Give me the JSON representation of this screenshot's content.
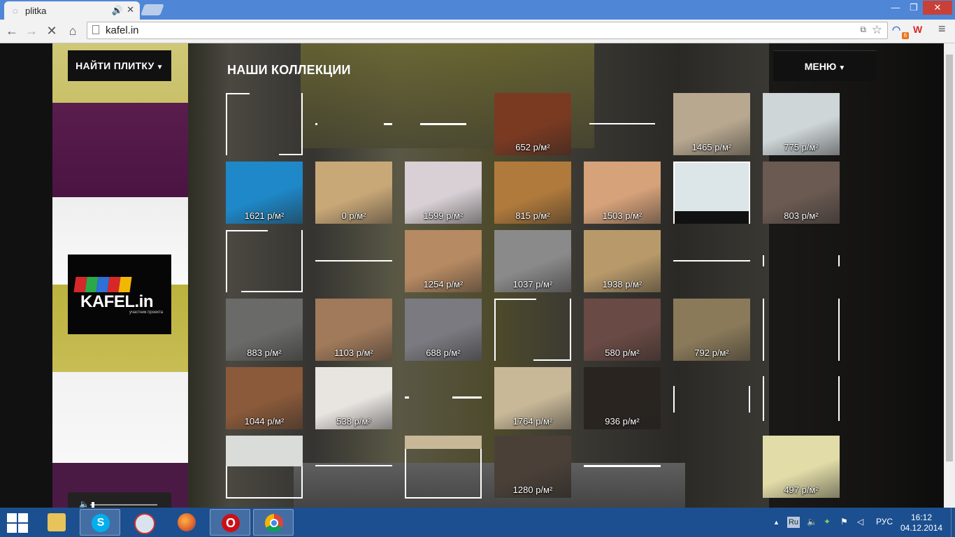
{
  "browser": {
    "tab_title": "plitka",
    "url": "kafel.in",
    "window_controls": [
      "minimize-icon",
      "maximize-icon",
      "close-icon"
    ]
  },
  "page": {
    "find_button": "НАЙТИ ПЛИТКУ",
    "menu_button": "МЕНЮ",
    "collections_title": "НАШИ КОЛЛЕКЦИИ",
    "logo": {
      "text": "KAFEL.in",
      "subtitle": "участник проекта",
      "stripe_colors": [
        "#d62828",
        "#2aa84a",
        "#2e6fd8",
        "#d62828",
        "#f2b705"
      ]
    },
    "tiles": [
      {
        "price": "652 р/м²",
        "photo": "#7a3a22"
      },
      {
        "price": "1465 р/м²",
        "photo": "#b8a890"
      },
      {
        "price": "775 р/м²",
        "photo": "#cfd6d8"
      },
      {
        "price": "1621 р/м²",
        "photo": "#1e88c8"
      },
      {
        "price": "0 р/м²",
        "photo": "#c9a878"
      },
      {
        "price": "1599 р/м²",
        "photo": "#d8d0d4"
      },
      {
        "price": "815 р/м²",
        "photo": "#b07a3c"
      },
      {
        "price": "1503 р/м²",
        "photo": "#d6a27a"
      },
      {
        "price": "803 р/м²",
        "photo": "#6a5a52"
      },
      {
        "price": "1254 р/м²",
        "photo": "#b68a62"
      },
      {
        "price": "1037 р/м²",
        "photo": "#8a8a8a"
      },
      {
        "price": "1938 р/м²",
        "photo": "#b89a6a"
      },
      {
        "price": "883 р/м²",
        "photo": "#6a6a68"
      },
      {
        "price": "1103 р/м²",
        "photo": "#a07a5a"
      },
      {
        "price": "688 р/м²",
        "photo": "#7a7a80"
      },
      {
        "price": "580 р/м²",
        "photo": "#6a4a44"
      },
      {
        "price": "792 р/м²",
        "photo": "#8a7a5a"
      },
      {
        "price": "1044 р/м²",
        "photo": "#8a5a3a"
      },
      {
        "price": "538 р/м²",
        "photo": "#e8e4e0"
      },
      {
        "price": "1764 р/м²",
        "photo": "#c8b898"
      },
      {
        "price": "936 р/м²",
        "photo": "#2a2420"
      },
      {
        "price": "1280 р/м²",
        "photo": "#4a4038"
      },
      {
        "price": "497 р/м²",
        "photo": "#e2dca8"
      }
    ]
  },
  "taskbar": {
    "apps": [
      "explorer-icon",
      "skype-icon",
      "agent-icon",
      "firefox-icon",
      "opera-icon",
      "chrome-icon"
    ],
    "tray_lang_indicator": "Ru",
    "input_language": "РУС",
    "time": "16:12",
    "date": "04.12.2014"
  }
}
